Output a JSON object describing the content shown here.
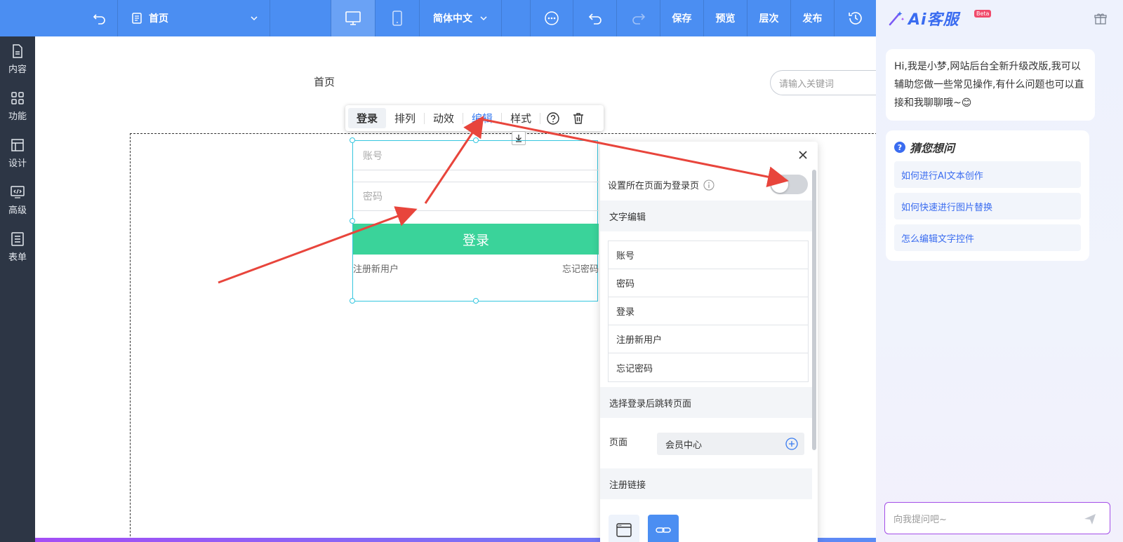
{
  "toolbar": {
    "page_name": "首页",
    "language": "简体中文",
    "save": "保存",
    "preview": "预览",
    "layers": "层次",
    "publish": "发布"
  },
  "sidebar": {
    "items": [
      {
        "label": "内容",
        "icon": "document-icon"
      },
      {
        "label": "功能",
        "icon": "grid-icon"
      },
      {
        "label": "设计",
        "icon": "layout-icon"
      },
      {
        "label": "高级",
        "icon": "code-monitor-icon"
      },
      {
        "label": "表单",
        "icon": "form-icon"
      }
    ]
  },
  "canvas": {
    "page_label": "首页",
    "search_placeholder": "请输入关键词"
  },
  "float_toolbar": {
    "items": [
      "登录",
      "排列",
      "动效",
      "编辑",
      "样式"
    ],
    "active": "编辑"
  },
  "login_widget": {
    "account_placeholder": "账号",
    "password_placeholder": "密码",
    "login_button": "登录",
    "register_link": "注册新用户",
    "forgot_link": "忘记密码",
    "button_color": "#3ad39a"
  },
  "settings_panel": {
    "toggle_label": "设置所在页面为登录页",
    "toggle_on": false,
    "text_edit_title": "文字编辑",
    "text_items": [
      "账号",
      "密码",
      "登录",
      "注册新用户",
      "忘记密码"
    ],
    "redirect_title": "选择登录后跳转页面",
    "redirect_label": "页面",
    "redirect_value": "会员中心",
    "register_link_title": "注册链接"
  },
  "ai_panel": {
    "logo_text": "Ai客服",
    "beta": "Beta",
    "greeting": "Hi,我是小梦,网站后台全新升级改版,我可以辅助您做一些常见操作,有什么问题也可以直接和我聊聊哦~😊",
    "suggest_title": "猜您想问",
    "suggestions": [
      "如何进行AI文本创作",
      "如何快速进行图片替换",
      "怎么编辑文字控件"
    ],
    "input_placeholder": "向我提问吧~"
  },
  "colors": {
    "toolbar_bg": "#4b8ef2",
    "sidebar_bg": "#2d3645",
    "accent": "#3a6cf0",
    "arrow": "#e8453c"
  }
}
